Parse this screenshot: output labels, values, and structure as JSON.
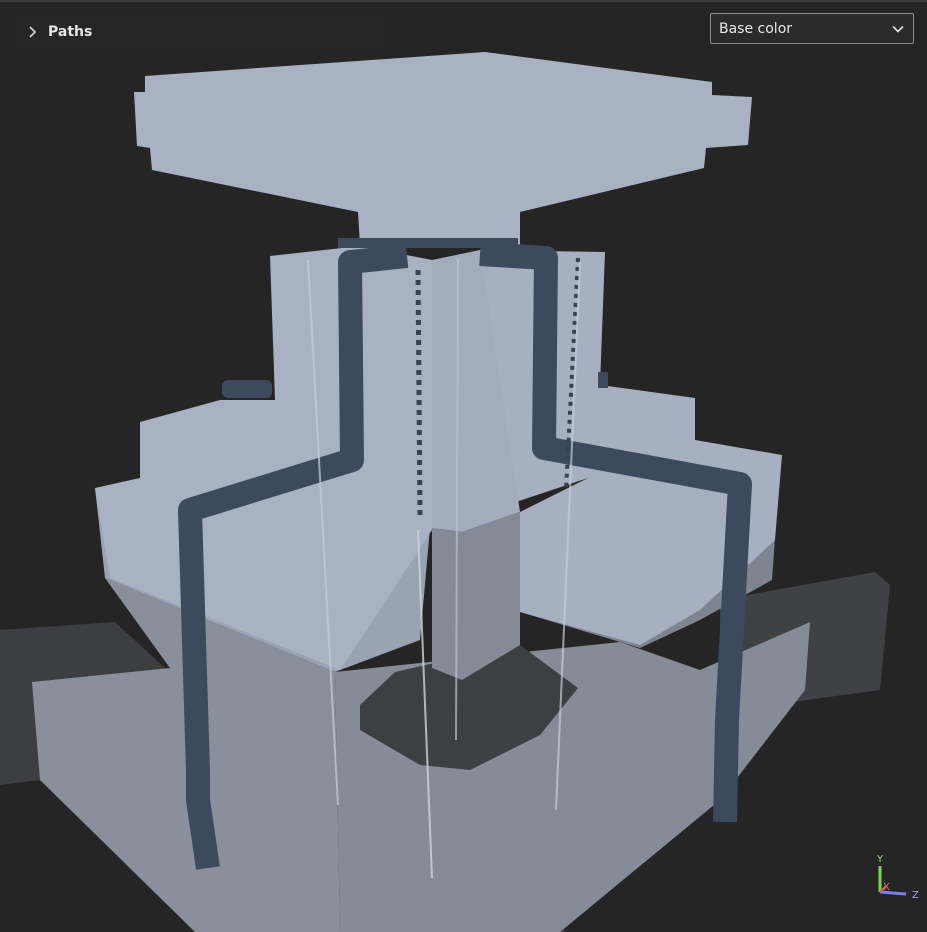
{
  "panel": {
    "paths_label": "Paths"
  },
  "view_mode": {
    "selected": "Base color"
  },
  "axes": {
    "y": "Y",
    "x": "X",
    "z": "Z"
  },
  "colors": {
    "background": "#252526",
    "part_light": "#a8b2c2",
    "part_shadow": "#848a96",
    "path_channel": "#3d4a5e",
    "base_plate": "#3f4145"
  }
}
